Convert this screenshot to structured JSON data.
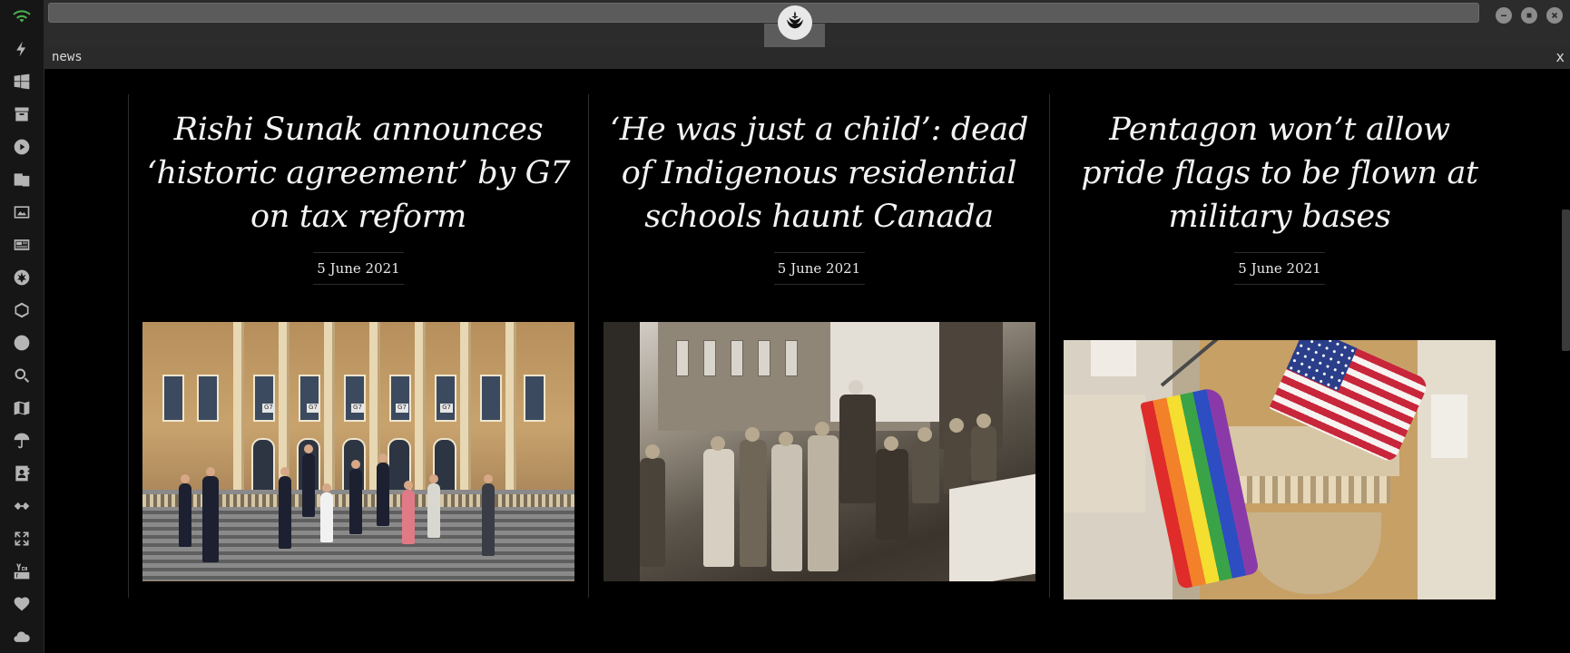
{
  "window": {
    "tab_title": "news",
    "close_label": "x"
  },
  "dock": {
    "icons": [
      "wifi-icon",
      "bolt-icon",
      "windows-icon",
      "archive-icon",
      "play-icon",
      "translate-icon",
      "image-icon",
      "newspaper-icon",
      "rebel-icon",
      "hexagon-icon",
      "globe-icon",
      "search-icon",
      "map-icon",
      "umbrella-icon",
      "contact-icon",
      "link-icon",
      "expand-icon",
      "youtube-icon",
      "heart-icon",
      "cloud-icon"
    ]
  },
  "articles": [
    {
      "headline": "Rishi Sunak announces ‘historic agreement’ by G7 on tax reform",
      "date": "5 June 2021"
    },
    {
      "headline": "‘He was just a child’: dead of Indigenous residential schools haunt Canada",
      "date": "5 June 2021"
    },
    {
      "headline": "Pentagon won’t allow pride flags to be flown at military bases",
      "date": "5 June 2021"
    }
  ],
  "palace_sign": "G7",
  "colors": {
    "background": "#000000",
    "dock": "#161616",
    "topbar": "#2c2c2c",
    "accent_wifi": "#4caf50"
  }
}
